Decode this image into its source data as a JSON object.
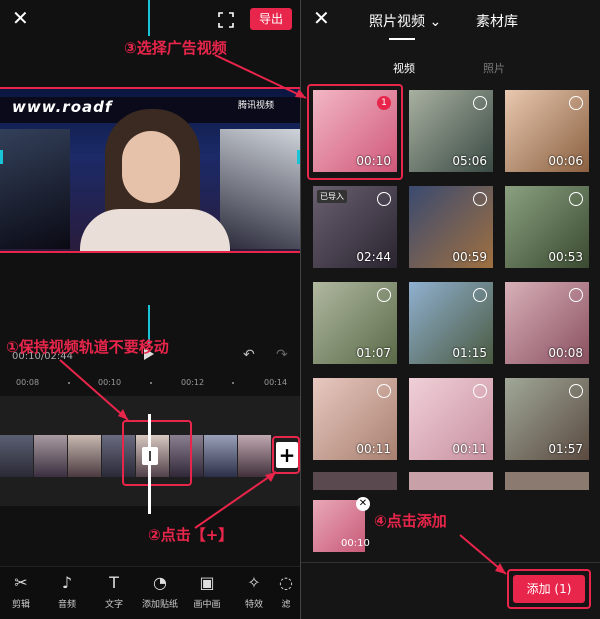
{
  "left": {
    "export_label": "导出",
    "timecode": "00:10/02:44",
    "video_banner": "www.roadf",
    "video_logo": "腾讯视频",
    "ruler": [
      "00:08",
      "00:10",
      "00:12",
      "00:14"
    ],
    "toolbar": [
      {
        "label": "剪辑",
        "icon": "scissors-icon",
        "glyph": "✂"
      },
      {
        "label": "音频",
        "icon": "music-icon",
        "glyph": "♪"
      },
      {
        "label": "文字",
        "icon": "text-icon",
        "glyph": "T"
      },
      {
        "label": "添加贴纸",
        "icon": "sticker-icon",
        "glyph": "◔"
      },
      {
        "label": "画中画",
        "icon": "pip-icon",
        "glyph": "▣"
      },
      {
        "label": "特效",
        "icon": "effects-icon",
        "glyph": "✧"
      },
      {
        "label": "滤",
        "icon": "filter-icon",
        "glyph": "◌"
      }
    ],
    "plus_label": "+"
  },
  "annotations": {
    "step1": "①保持视频轨道不要移动",
    "step2": "②点击【+】",
    "step3": "③选择广告视频",
    "step4": "④点击添加"
  },
  "right": {
    "tab_main": "照片视频 ⌄",
    "tab_library": "素材库",
    "sub_video": "视频",
    "sub_photo": "照片",
    "thumbs": [
      {
        "duration": "00:10",
        "badge": "1",
        "selected": true
      },
      {
        "duration": "05:06"
      },
      {
        "duration": "00:06"
      },
      {
        "duration": "02:44",
        "imported": "已导入"
      },
      {
        "duration": "00:59"
      },
      {
        "duration": "00:53"
      },
      {
        "duration": "01:07"
      },
      {
        "duration": "01:15"
      },
      {
        "duration": "00:08"
      },
      {
        "duration": "00:11"
      },
      {
        "duration": "00:11"
      },
      {
        "duration": "01:57"
      }
    ],
    "selected_duration": "00:10",
    "add_label": "添加 (1)"
  },
  "colors": {
    "accent": "#e8254a",
    "cyan": "#19c4d6"
  }
}
